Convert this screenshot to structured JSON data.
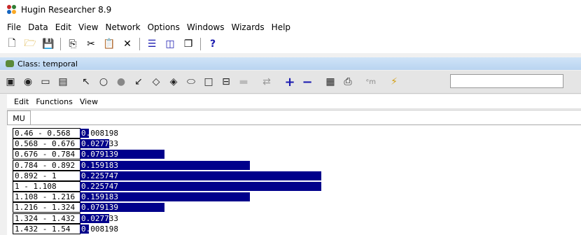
{
  "window": {
    "title": "Hugin Researcher 8.9"
  },
  "menu": [
    "File",
    "Data",
    "Edit",
    "View",
    "Network",
    "Options",
    "Windows",
    "Wizards",
    "Help"
  ],
  "toolbar_icons": [
    "new-icon",
    "open-icon",
    "save-icon",
    "copy-icon",
    "cut-icon",
    "paste-icon",
    "delete-icon",
    "layout-icon",
    "split-icon",
    "windows-icon",
    "help-icon"
  ],
  "class_window": {
    "title": "Class: temporal"
  },
  "class_toolbar_icons": [
    "properties-icon",
    "camera-icon",
    "monitor-icon",
    "node-list-icon",
    "pointer-icon",
    "chance-node-icon",
    "discrete-node-icon",
    "link-icon",
    "decision-node-icon",
    "utility-node-icon",
    "instance-icon",
    "function-node-icon",
    "label-icon",
    "arrows-icon",
    "plus-icon",
    "minus-icon",
    "table-icon",
    "print-icon",
    "em-icon",
    "lightning-icon"
  ],
  "submenu": [
    "Edit",
    "Functions",
    "View"
  ],
  "tab": "MU",
  "colors": {
    "bar": "#00008b"
  },
  "states": [
    {
      "label": "0.46 - 0.568",
      "value": "0.008198",
      "prob": 0.008198
    },
    {
      "label": "0.568 - 0.676",
      "value": "0.027733",
      "prob": 0.027733
    },
    {
      "label": "0.676 - 0.784",
      "value": "0.079139",
      "prob": 0.079139
    },
    {
      "label": "0.784 - 0.892",
      "value": "0.159183",
      "prob": 0.159183
    },
    {
      "label": "0.892 - 1",
      "value": "0.225747",
      "prob": 0.225747
    },
    {
      "label": "1 - 1.108",
      "value": "0.225747",
      "prob": 0.225747
    },
    {
      "label": "1.108 - 1.216",
      "value": "0.159183",
      "prob": 0.159183
    },
    {
      "label": "1.216 - 1.324",
      "value": "0.079139",
      "prob": 0.079139
    },
    {
      "label": "1.324 - 1.432",
      "value": "0.027733",
      "prob": 0.027733
    },
    {
      "label": "1.432 - 1.54",
      "value": "0.008198",
      "prob": 0.008198
    }
  ]
}
